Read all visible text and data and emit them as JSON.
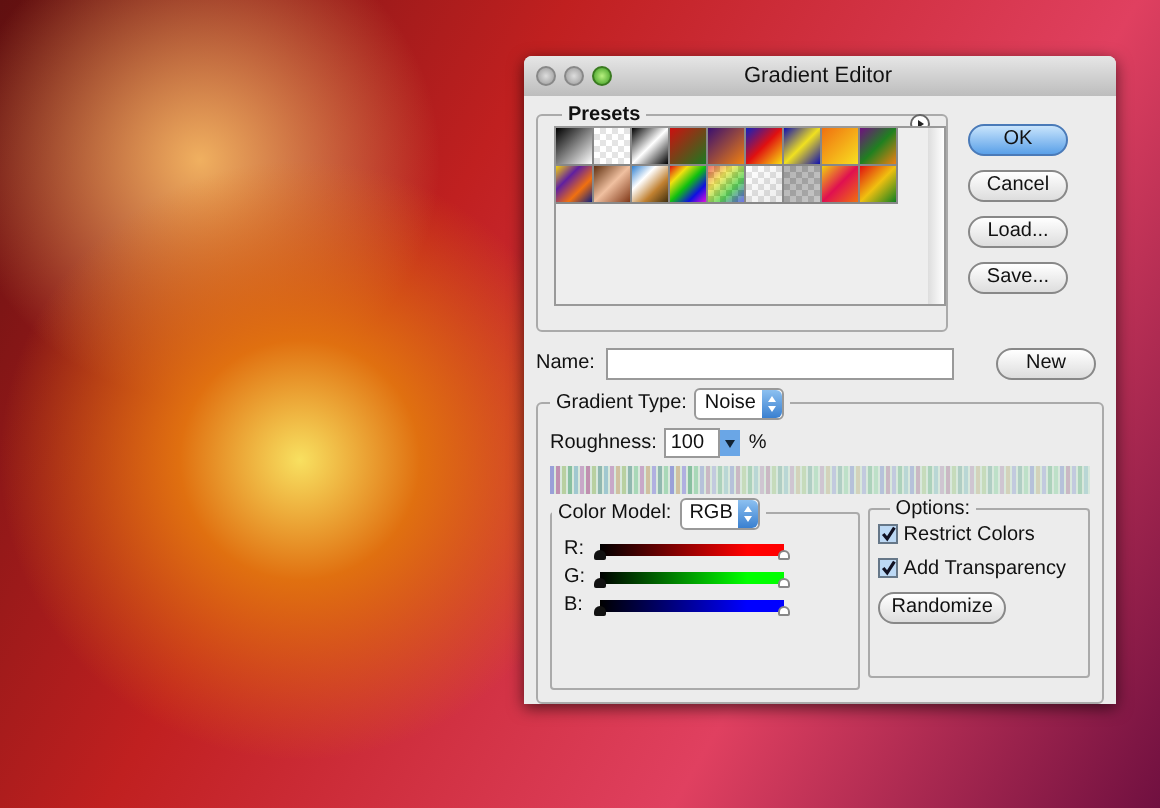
{
  "window": {
    "title": "Gradient Editor"
  },
  "presets": {
    "label": "Presets"
  },
  "buttons": [
    {
      "label": "OK",
      "default": true
    },
    {
      "label": "Cancel",
      "default": false
    },
    {
      "label": "Load...",
      "default": false
    },
    {
      "label": "Save...",
      "default": false
    }
  ],
  "name_field": {
    "label": "Name:"
  },
  "new_button": "New",
  "gradient_type": {
    "label": "Gradient Type:",
    "value": "Noise"
  },
  "roughness": {
    "label": "Roughness:",
    "value": "100",
    "unit": "%"
  },
  "color_model": {
    "label": "Color Model:",
    "value": "RGB",
    "channels": [
      {
        "label": "R:",
        "color": "#ff0000",
        "handles": [
          {
            "level": 0
          },
          {
            "level": 1
          }
        ]
      },
      {
        "label": "G:",
        "color": "#00ff00",
        "handles": [
          {
            "level": 0
          },
          {
            "level": 1
          }
        ]
      },
      {
        "label": "B:",
        "color": "#0000ff",
        "handles": [
          {
            "level": 0
          },
          {
            "level": 1
          }
        ]
      }
    ]
  },
  "options": {
    "label": "Options:",
    "checkboxes": [
      {
        "label": "Restrict Colors",
        "checked": true
      },
      {
        "label": "Add Transparency",
        "checked": true
      }
    ],
    "randomize": "Randomize"
  }
}
